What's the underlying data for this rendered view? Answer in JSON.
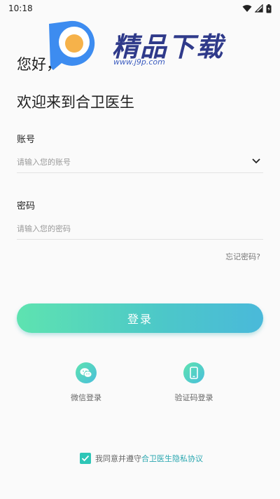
{
  "status_bar": {
    "time": "10:18"
  },
  "watermark": {
    "brand": "精品下载",
    "url": "www.j9p.com"
  },
  "greeting": "您好，",
  "welcome": "欢迎来到合卫医生",
  "account": {
    "label": "账号",
    "placeholder": "请输入您的账号",
    "value": ""
  },
  "password": {
    "label": "密码",
    "placeholder": "请输入您的密码",
    "value": ""
  },
  "forgot_password": "忘记密码?",
  "login_button": "登录",
  "alt_logins": [
    {
      "label": "微信登录",
      "icon": "wechat-icon"
    },
    {
      "label": "验证码登录",
      "icon": "phone-icon"
    }
  ],
  "agreement": {
    "prefix": "我同意并遵守",
    "link": "合卫医生隐私协议",
    "checked": true
  },
  "colors": {
    "accent_start": "#5ee3b0",
    "accent_end": "#4ab9da",
    "link": "#2aa7b0"
  }
}
